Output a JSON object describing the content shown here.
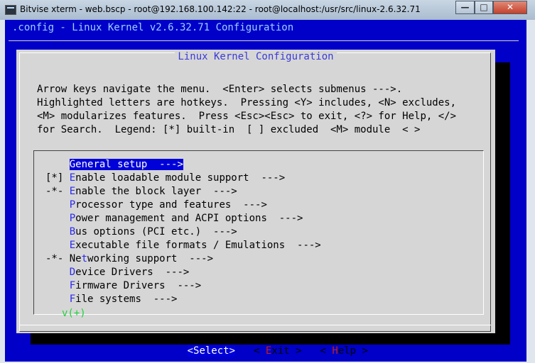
{
  "window": {
    "title": "Bitvise xterm - web.bscp - root@192.168.100.142:22 - root@localhost:/usr/src/linux-2.6.32.71",
    "min_label": "—",
    "max_label": "□",
    "close_label": "✕"
  },
  "terminal": {
    "header": ".config - Linux Kernel v2.6.32.71 Configuration"
  },
  "dialog": {
    "title": "Linux Kernel Configuration",
    "instructions": [
      "Arrow keys navigate the menu.  <Enter> selects submenus --->.",
      "Highlighted letters are hotkeys.  Pressing <Y> includes, <N> excludes,",
      "<M> modularizes features.  Press <Esc><Esc> to exit, <?> for Help, </>",
      "for Search.  Legend: [*] built-in  [ ] excluded  <M> module  < >"
    ],
    "menu": [
      {
        "prefix": "    ",
        "hotkey": "G",
        "rest": "eneral setup  --->",
        "selected": true
      },
      {
        "prefix": "[*] ",
        "hotkey": "E",
        "rest": "nable loadable module support  --->",
        "selected": false
      },
      {
        "prefix": "-*- ",
        "hotkey": "E",
        "rest": "nable the block layer  --->",
        "selected": false
      },
      {
        "prefix": "    ",
        "hotkey": "P",
        "rest": "rocessor type and features  --->",
        "selected": false
      },
      {
        "prefix": "    ",
        "hotkey": "P",
        "rest": "ower management and ACPI options  --->",
        "selected": false
      },
      {
        "prefix": "    ",
        "hotkey": "B",
        "rest": "us options (PCI etc.)  --->",
        "selected": false
      },
      {
        "prefix": "    ",
        "hotkey": "E",
        "rest": "xecutable file formats / Emulations  --->",
        "selected": false
      },
      {
        "prefix": "-*- ",
        "hotkey": "N",
        "pre": "Ne",
        "hotkey2": "t",
        "rest": "working support  --->",
        "selected": false
      },
      {
        "prefix": "    ",
        "hotkey": "D",
        "rest": "evice Drivers  --->",
        "selected": false
      },
      {
        "prefix": "    ",
        "hotkey": "F",
        "rest": "irmware Drivers  --->",
        "selected": false
      },
      {
        "prefix": "    ",
        "hotkey": "F",
        "rest": "ile systems  --->",
        "selected": false
      }
    ],
    "more_indicator": "v(+)",
    "buttons": {
      "select": {
        "lbr": "<",
        "hotkey": "S",
        "rest": "elect",
        "rbr": ">"
      },
      "exit": {
        "lbr": "< ",
        "hotkey": "E",
        "rest": "xit",
        "rbr": " >"
      },
      "help": {
        "lbr": "< ",
        "hotkey": "H",
        "rest": "elp",
        "rbr": " >"
      }
    }
  },
  "colors": {
    "terminal_bg": "#0000c8",
    "dialog_bg": "#d6d6d6",
    "selection": "#0000d8",
    "hotkey": "#2a2af0",
    "button_hotkey": "#c41e1e",
    "more_indicator": "#1ed23c"
  }
}
